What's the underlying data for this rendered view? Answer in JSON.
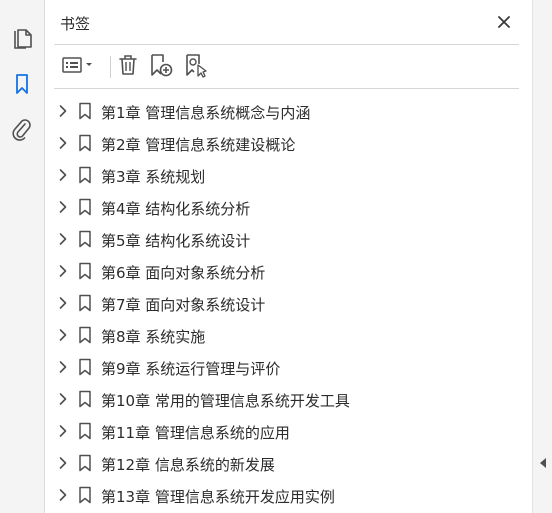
{
  "rail": {
    "items": [
      {
        "icon": "pages-icon",
        "active": false
      },
      {
        "icon": "bookmark-icon",
        "active": true
      },
      {
        "icon": "attachment-icon",
        "active": false
      }
    ]
  },
  "panel": {
    "title": "书签",
    "close_icon": "close-icon"
  },
  "toolbar": {
    "options_icon": "options-menu-icon",
    "delete_icon": "trash-icon",
    "new_bookmark_icon": "add-bookmark-icon",
    "find_bookmark_icon": "find-bookmark-icon"
  },
  "bookmarks": [
    {
      "label": "第1章  管理信息系统概念与内涵"
    },
    {
      "label": "第2章  管理信息系统建设概论"
    },
    {
      "label": "第3章  系统规划"
    },
    {
      "label": "第4章  结构化系统分析"
    },
    {
      "label": "第5章  结构化系统设计"
    },
    {
      "label": "第6章  面向对象系统分析"
    },
    {
      "label": "第7章  面向对象系统设计"
    },
    {
      "label": "第8章  系统实施"
    },
    {
      "label": "第9章  系统运行管理与评价"
    },
    {
      "label": "第10章  常用的管理信息系统开发工具"
    },
    {
      "label": "第11章  管理信息系统的应用"
    },
    {
      "label": "第12章  信息系统的新发展"
    },
    {
      "label": "第13章  管理信息系统开发应用实例"
    }
  ],
  "colors": {
    "accent": "#1473e6",
    "icon": "#505050",
    "text": "#2c2c2c"
  }
}
